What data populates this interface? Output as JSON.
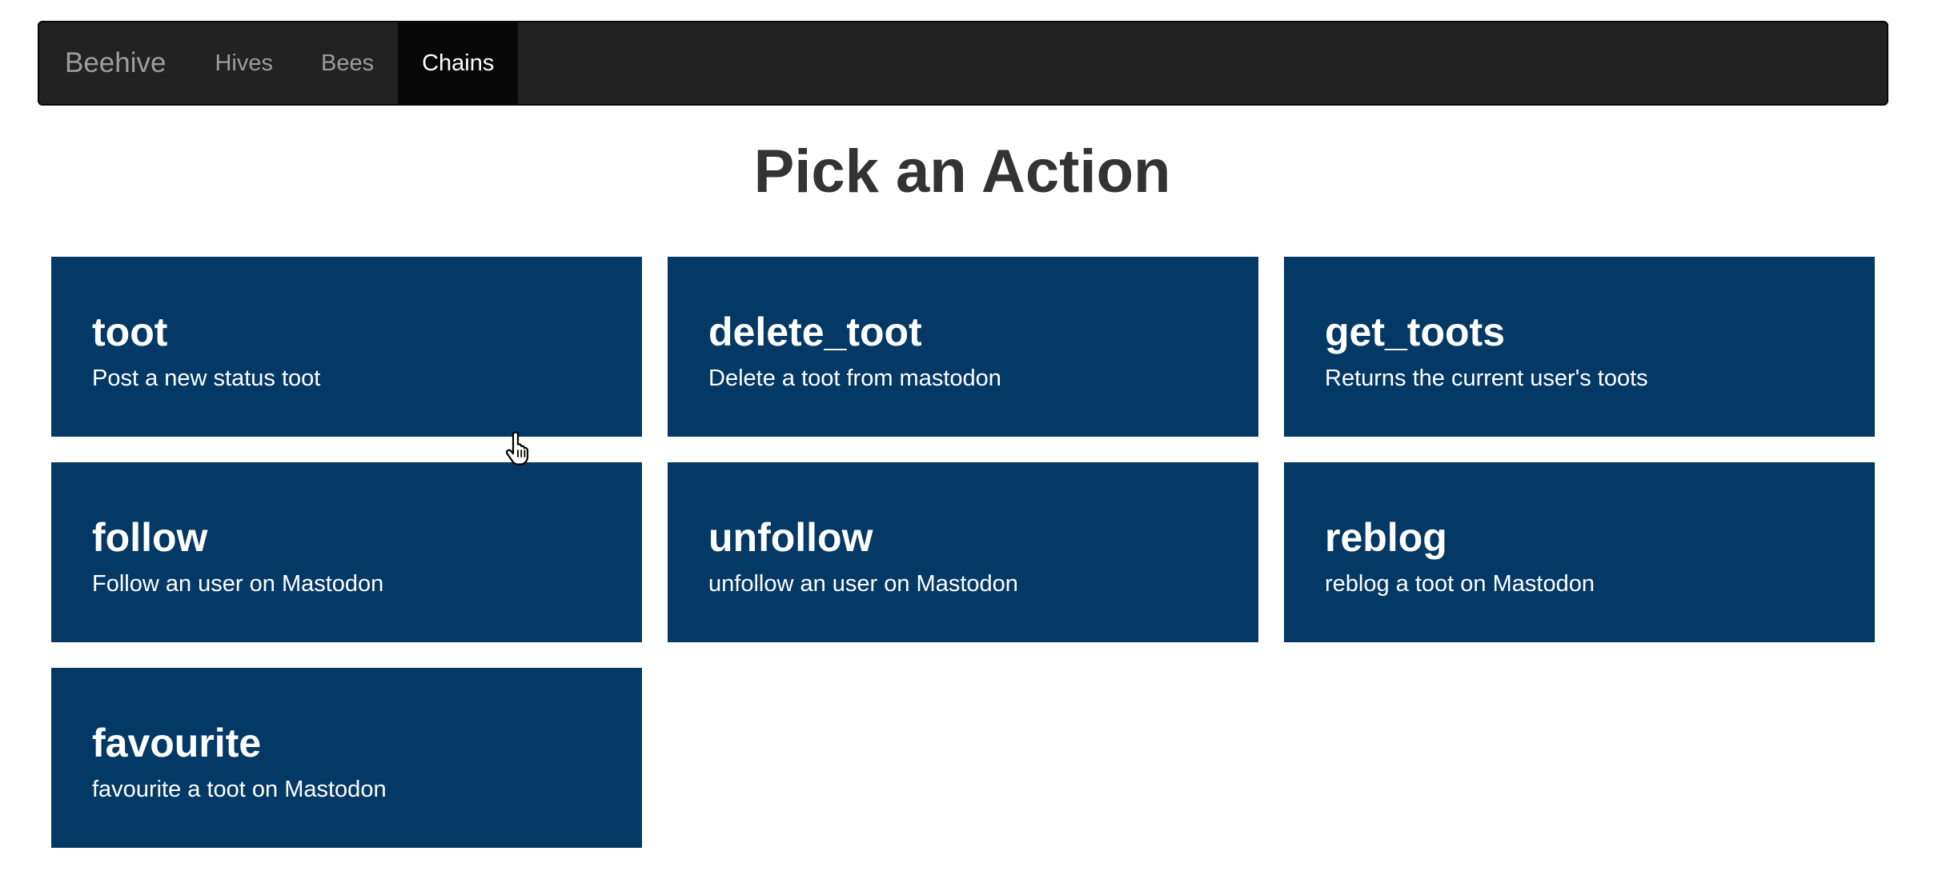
{
  "navbar": {
    "brand": "Beehive",
    "items": [
      {
        "label": "Hives",
        "active": false
      },
      {
        "label": "Bees",
        "active": false
      },
      {
        "label": "Chains",
        "active": true
      }
    ]
  },
  "page": {
    "title": "Pick an Action"
  },
  "actions": [
    {
      "name": "toot",
      "description": "Post a new status toot"
    },
    {
      "name": "delete_toot",
      "description": "Delete a toot from mastodon"
    },
    {
      "name": "get_toots",
      "description": "Returns the current user's toots"
    },
    {
      "name": "follow",
      "description": "Follow an user on Mastodon"
    },
    {
      "name": "unfollow",
      "description": "unfollow an user on Mastodon"
    },
    {
      "name": "reblog",
      "description": "reblog a toot on Mastodon"
    },
    {
      "name": "favourite",
      "description": "favourite a toot on Mastodon"
    }
  ],
  "colors": {
    "navbar_bg": "#222222",
    "navbar_active_bg": "#080808",
    "card_bg": "#043966",
    "title_text": "#333333"
  },
  "icons": {
    "cursor": "hand-pointer-cursor-icon"
  }
}
